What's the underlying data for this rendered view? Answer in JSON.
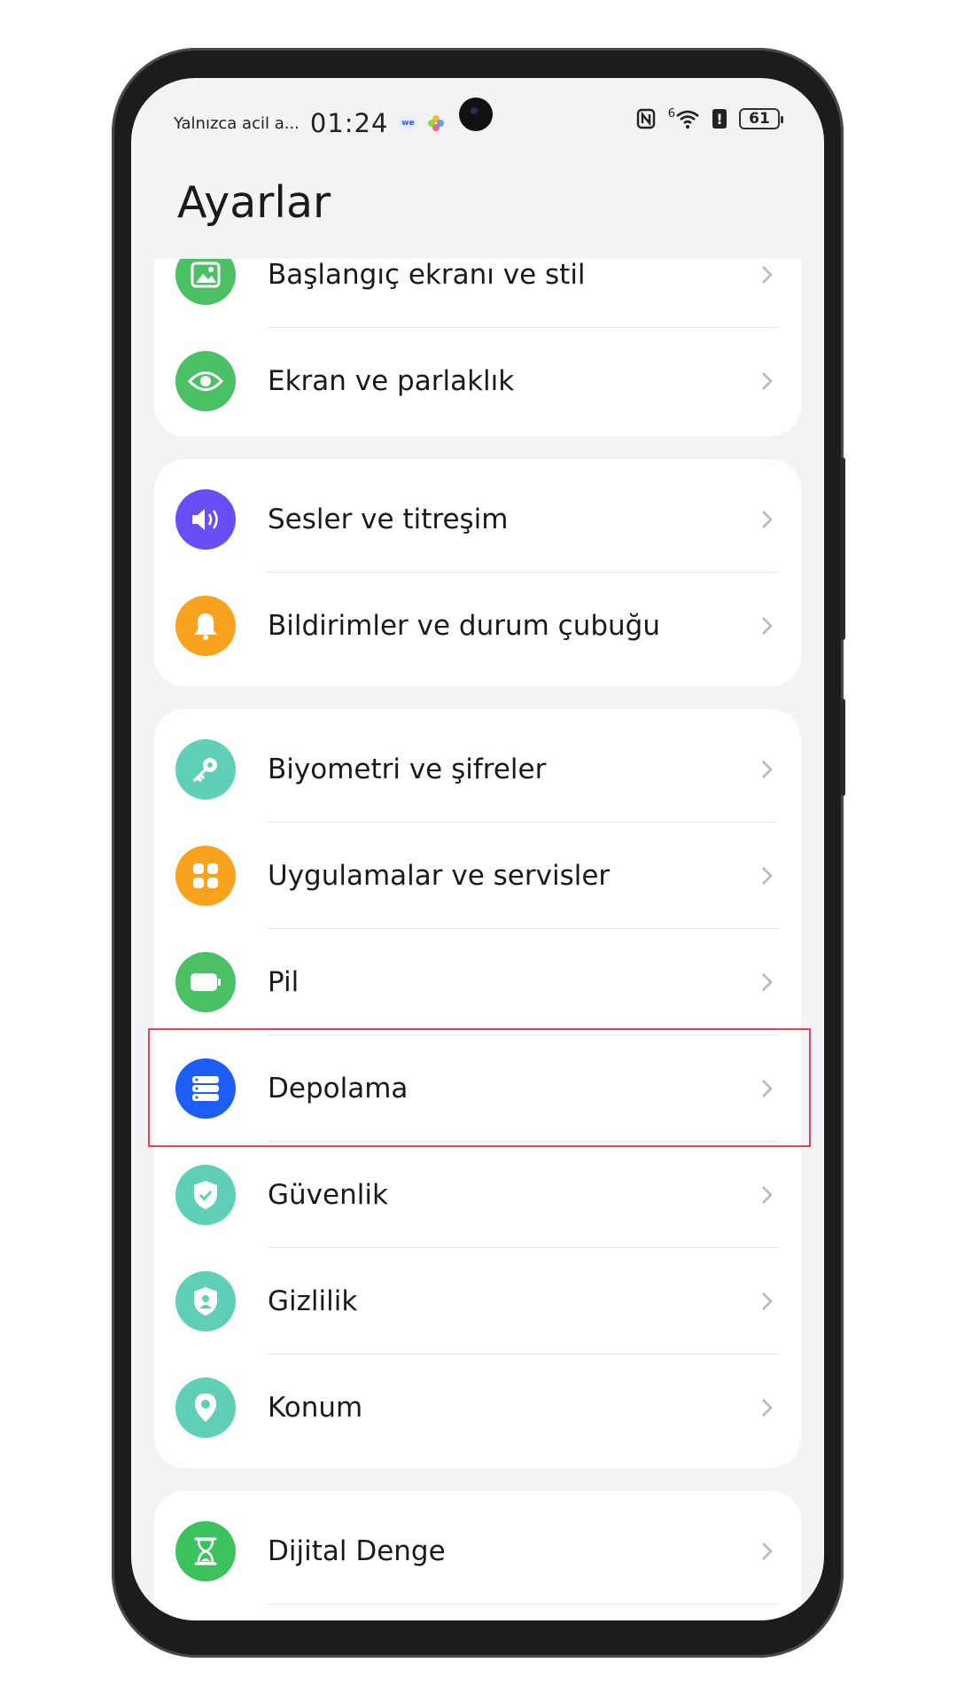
{
  "status_bar": {
    "carrier": "Yalnızca acil a...",
    "time": "01:24",
    "app_badge": "we",
    "network": "6",
    "battery": "61"
  },
  "page_title": "Ayarlar",
  "groups": [
    {
      "items": [
        {
          "label": "Başlangıç ekranı ve stil",
          "icon": "image-icon",
          "color": "#4cc064"
        },
        {
          "label": "Ekran ve parlaklık",
          "icon": "eye-icon",
          "color": "#4cc064"
        }
      ]
    },
    {
      "items": [
        {
          "label": "Sesler ve titreşim",
          "icon": "volume-icon",
          "color": "#6a4ef5"
        },
        {
          "label": "Bildirimler ve durum çubuğu",
          "icon": "bell-icon",
          "color": "#f9a21e"
        }
      ]
    },
    {
      "items": [
        {
          "label": "Biyometri ve şifreler",
          "icon": "key-icon",
          "color": "#5fcfb5"
        },
        {
          "label": "Uygulamalar ve servisler",
          "icon": "grid-icon",
          "color": "#f9a21e"
        },
        {
          "label": "Pil",
          "icon": "battery-icon",
          "color": "#4cc064"
        },
        {
          "label": "Depolama",
          "icon": "storage-icon",
          "color": "#1d5ef2"
        },
        {
          "label": "Güvenlik",
          "icon": "shield-check-icon",
          "color": "#5fcfb5"
        },
        {
          "label": "Gizlilik",
          "icon": "shield-user-icon",
          "color": "#5fcfb5"
        },
        {
          "label": "Konum",
          "icon": "location-pin-icon",
          "color": "#5fcfb5"
        }
      ]
    },
    {
      "items": [
        {
          "label": "Dijital Denge",
          "icon": "hourglass-icon",
          "color": "#3cc25c"
        }
      ]
    }
  ],
  "highlighted_item": "Depolama"
}
